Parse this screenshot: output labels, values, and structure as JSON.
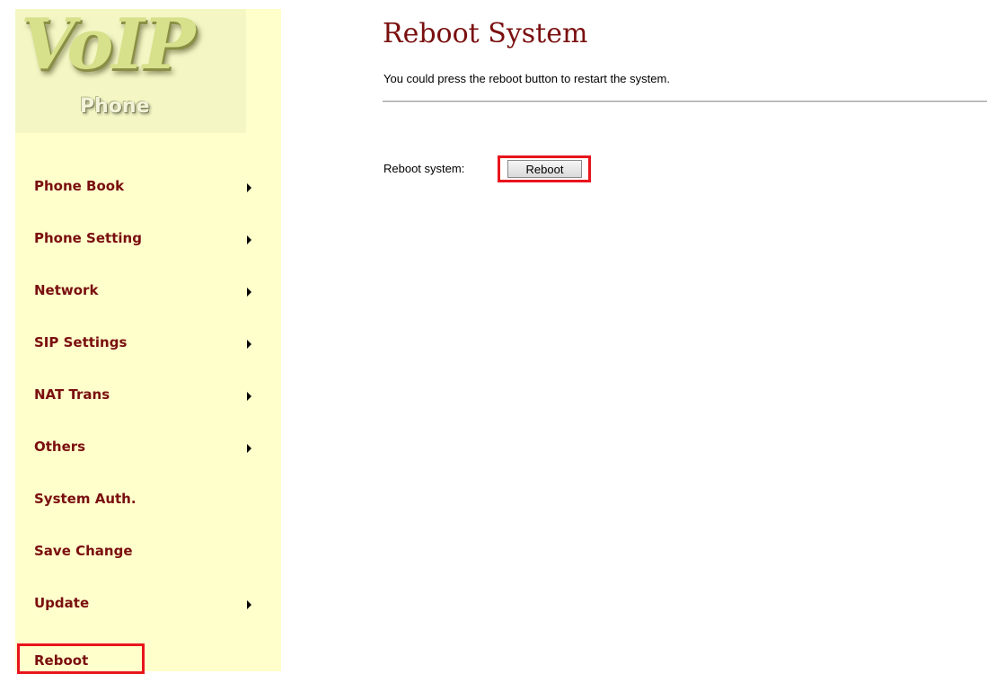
{
  "logo": {
    "main_text": "VoIP",
    "sub_text": "Phone"
  },
  "sidebar": {
    "items": [
      {
        "label": "Phone Book",
        "has_arrow": true
      },
      {
        "label": "Phone Setting",
        "has_arrow": true
      },
      {
        "label": "Network",
        "has_arrow": true
      },
      {
        "label": "SIP Settings",
        "has_arrow": true
      },
      {
        "label": "NAT Trans",
        "has_arrow": true
      },
      {
        "label": "Others",
        "has_arrow": true
      },
      {
        "label": "System Auth.",
        "has_arrow": false
      },
      {
        "label": "Save Change",
        "has_arrow": false
      },
      {
        "label": "Update",
        "has_arrow": true
      },
      {
        "label": "Reboot",
        "has_arrow": false,
        "active": true
      }
    ],
    "arrow_icon": "caret-right-icon"
  },
  "page": {
    "title": "Reboot System",
    "description": "You could press the reboot button to restart the system.",
    "reboot_label": "Reboot system:",
    "reboot_button": "Reboot"
  },
  "colors": {
    "sidebar_bg": "#ffffcc",
    "menu_text": "#7a0f0f",
    "title_text": "#7a0f0f",
    "highlight_border": "#e8141c"
  }
}
